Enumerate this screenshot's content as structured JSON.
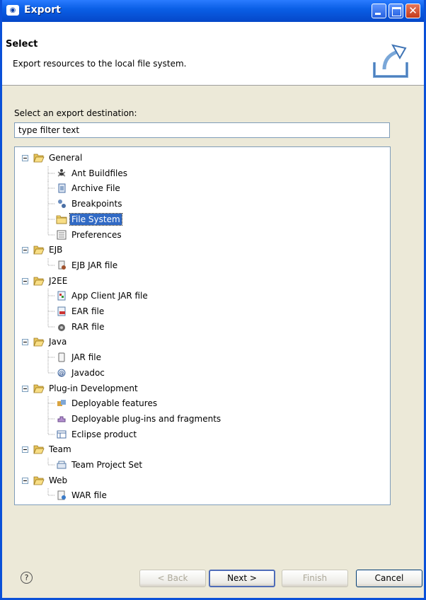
{
  "window": {
    "title": "Export",
    "icon": "eclipse-window-icon"
  },
  "header": {
    "title": "Select",
    "description": "Export resources to the local file system.",
    "image": "export-wizard-banner-icon"
  },
  "body": {
    "select_label": "Select an export destination:",
    "filter_value": "type filter text"
  },
  "tree": {
    "groups": [
      {
        "label": "General",
        "items": [
          {
            "label": "Ant Buildfiles",
            "icon": "ant-icon"
          },
          {
            "label": "Archive File",
            "icon": "archive-icon"
          },
          {
            "label": "Breakpoints",
            "icon": "breakpoints-icon"
          },
          {
            "label": "File System",
            "icon": "folder-icon",
            "selected": true
          },
          {
            "label": "Preferences",
            "icon": "preferences-icon"
          }
        ]
      },
      {
        "label": "EJB",
        "items": [
          {
            "label": "EJB JAR file",
            "icon": "ejb-jar-icon"
          }
        ]
      },
      {
        "label": "J2EE",
        "items": [
          {
            "label": "App Client JAR file",
            "icon": "app-client-icon"
          },
          {
            "label": "EAR file",
            "icon": "ear-icon"
          },
          {
            "label": "RAR file",
            "icon": "rar-icon"
          }
        ]
      },
      {
        "label": "Java",
        "items": [
          {
            "label": "JAR file",
            "icon": "jar-icon"
          },
          {
            "label": "Javadoc",
            "icon": "javadoc-icon"
          }
        ]
      },
      {
        "label": "Plug-in Development",
        "items": [
          {
            "label": "Deployable features",
            "icon": "features-icon"
          },
          {
            "label": "Deployable plug-ins and fragments",
            "icon": "plugins-icon"
          },
          {
            "label": "Eclipse product",
            "icon": "product-icon"
          }
        ]
      },
      {
        "label": "Team",
        "items": [
          {
            "label": "Team Project Set",
            "icon": "team-project-set-icon"
          }
        ]
      },
      {
        "label": "Web",
        "items": [
          {
            "label": "WAR file",
            "icon": "war-icon"
          }
        ]
      }
    ]
  },
  "buttons": {
    "help": "?",
    "back": "< Back",
    "next": "Next >",
    "finish": "Finish",
    "cancel": "Cancel"
  },
  "colors": {
    "titlebar": "#0A5FE6",
    "selection": "#316AC5",
    "folder": "#F5D56A"
  }
}
